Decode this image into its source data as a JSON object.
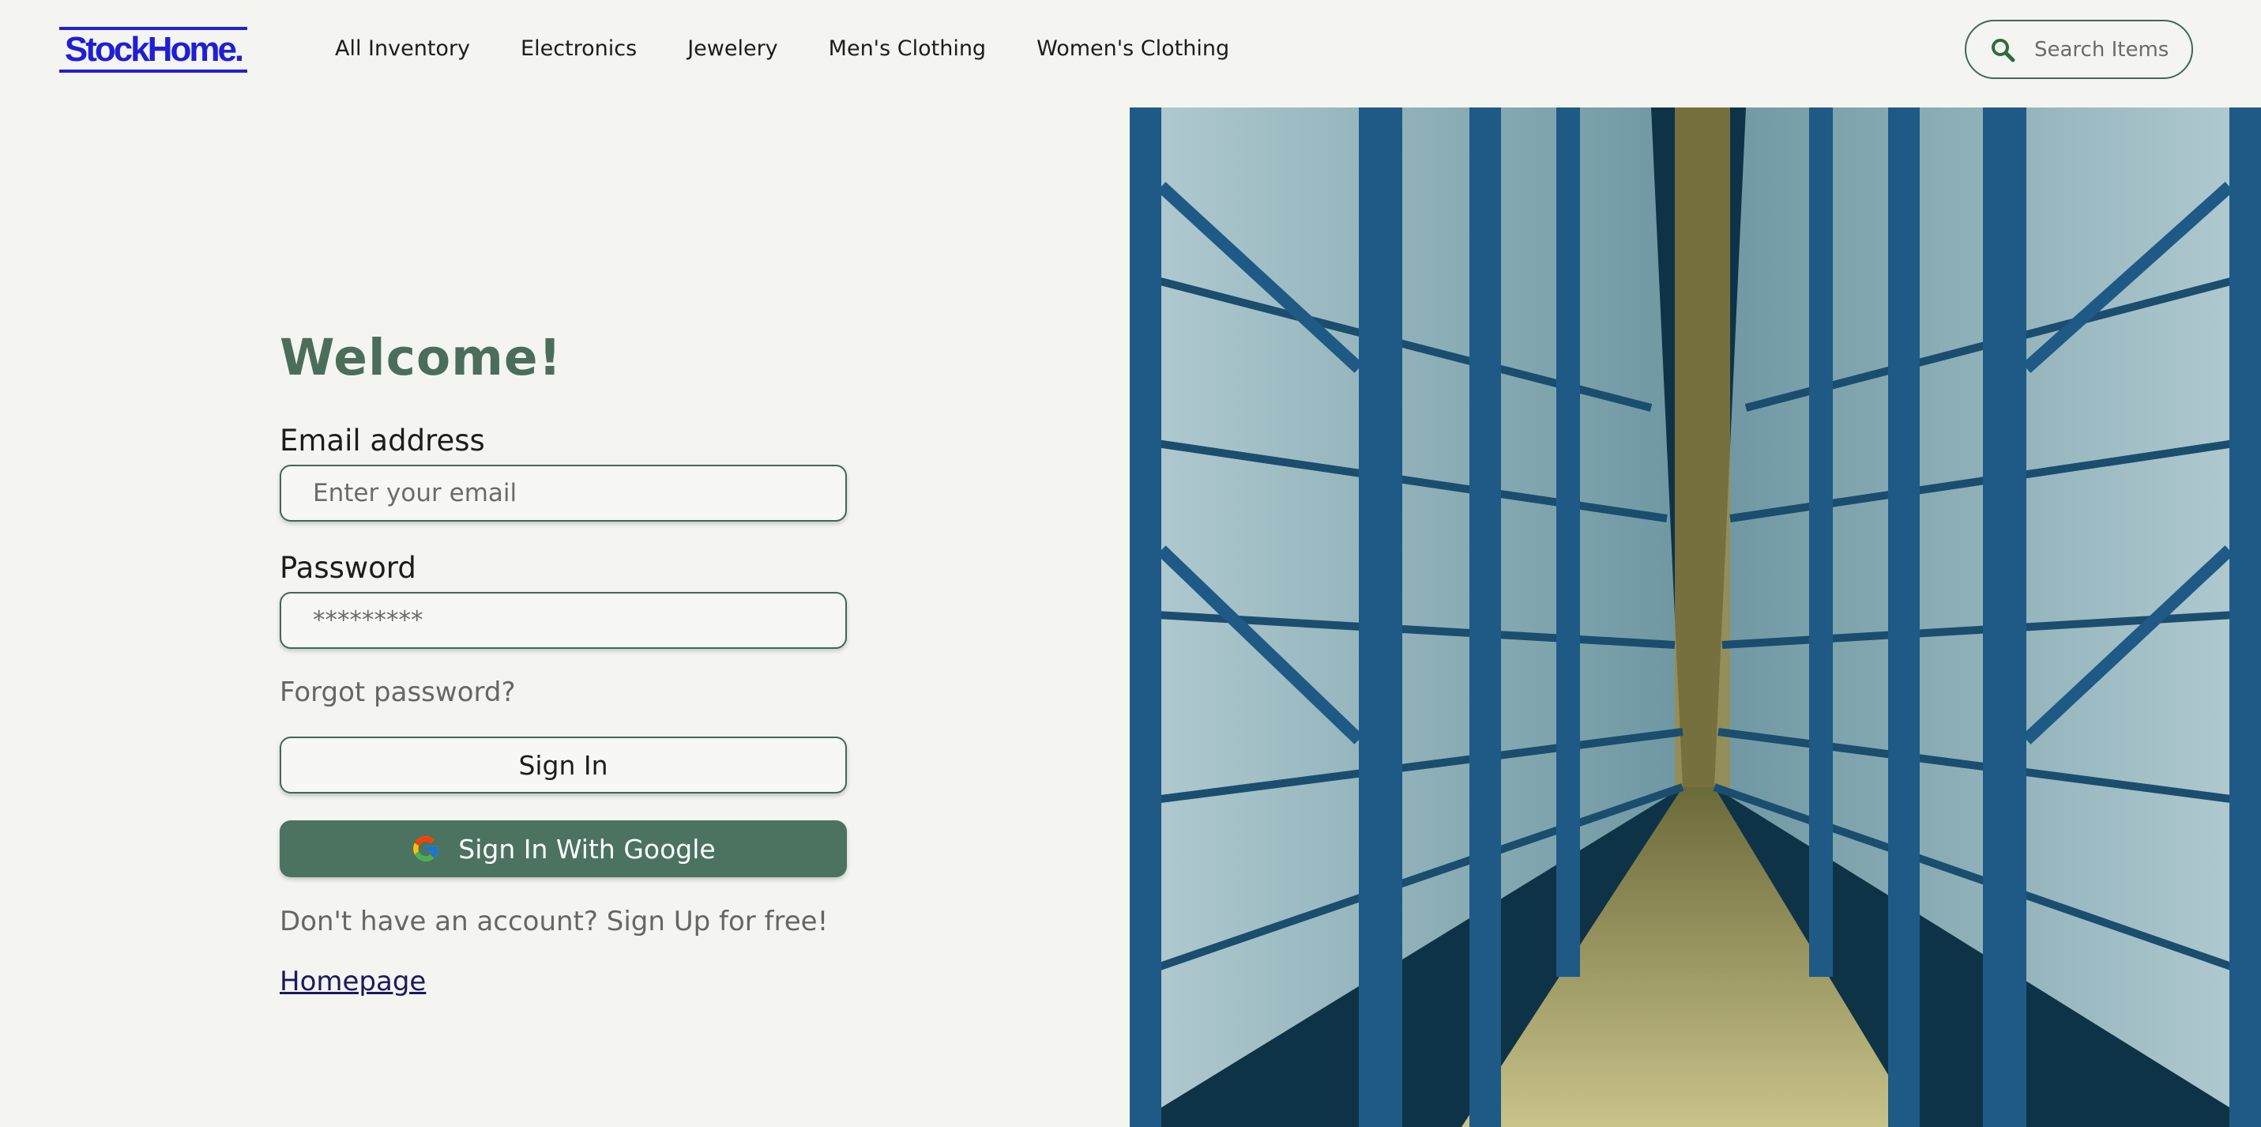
{
  "header": {
    "logo": "StockHome.",
    "nav": [
      "All Inventory",
      "Electronics",
      "Jewelery",
      "Men's Clothing",
      "Women's Clothing"
    ],
    "search_placeholder": "Search Items"
  },
  "login": {
    "title": "Welcome!",
    "email_label": "Email address",
    "email_placeholder": "Enter your email",
    "password_label": "Password",
    "password_placeholder": "*********",
    "forgot": "Forgot password?",
    "signin": "Sign In",
    "google": "Sign In With Google",
    "signup_text": "Don't have an account? Sign Up for free!",
    "homepage": "Homepage"
  },
  "icons": {
    "search": "search-icon",
    "google": "google-icon"
  },
  "colors": {
    "brand": "#1f1fd6",
    "accent": "#4b735f",
    "background": "#f4f5f0"
  }
}
